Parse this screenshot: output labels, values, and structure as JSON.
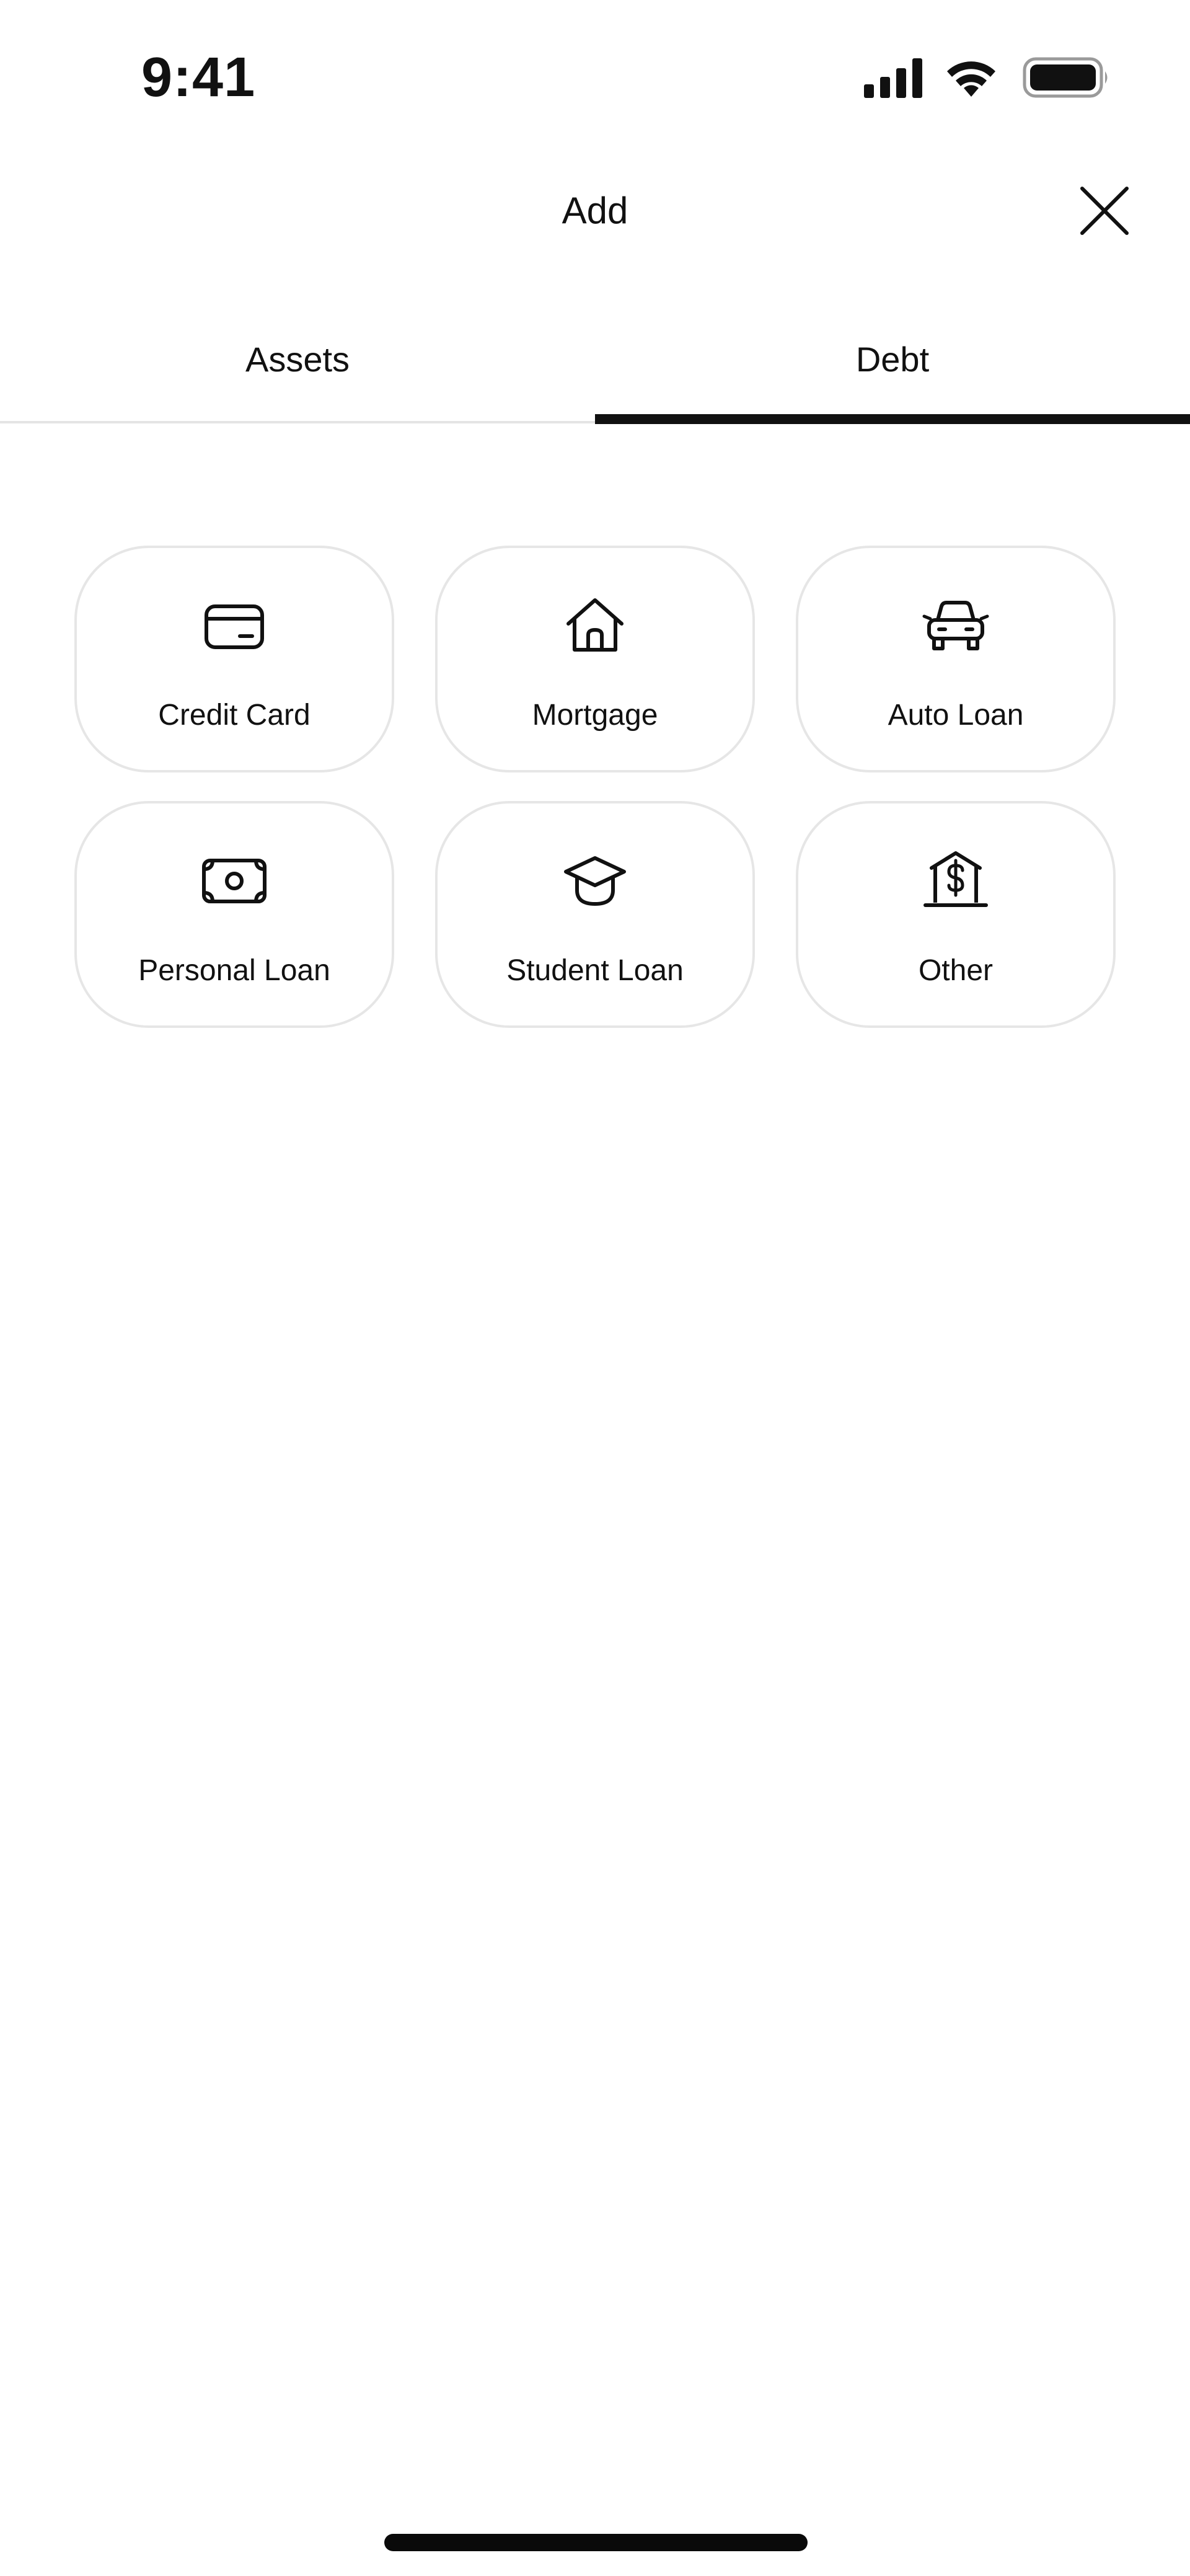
{
  "status_bar": {
    "time": "9:41"
  },
  "header": {
    "title": "Add"
  },
  "tabs": [
    {
      "label": "Assets",
      "selected": false
    },
    {
      "label": "Debt",
      "selected": true
    }
  ],
  "debt_types": [
    {
      "label": "Credit Card",
      "icon": "credit-card-icon"
    },
    {
      "label": "Mortgage",
      "icon": "house-icon"
    },
    {
      "label": "Auto Loan",
      "icon": "car-icon"
    },
    {
      "label": "Personal Loan",
      "icon": "banknote-icon"
    },
    {
      "label": "Student Loan",
      "icon": "graduation-cap-icon"
    },
    {
      "label": "Other",
      "icon": "bank-dollar-icon"
    }
  ],
  "colors": {
    "text": "#111111",
    "tile_border": "#e6e6e6",
    "tab_divider": "#e4e4e4",
    "active_indicator": "#111111",
    "background": "#ffffff"
  }
}
